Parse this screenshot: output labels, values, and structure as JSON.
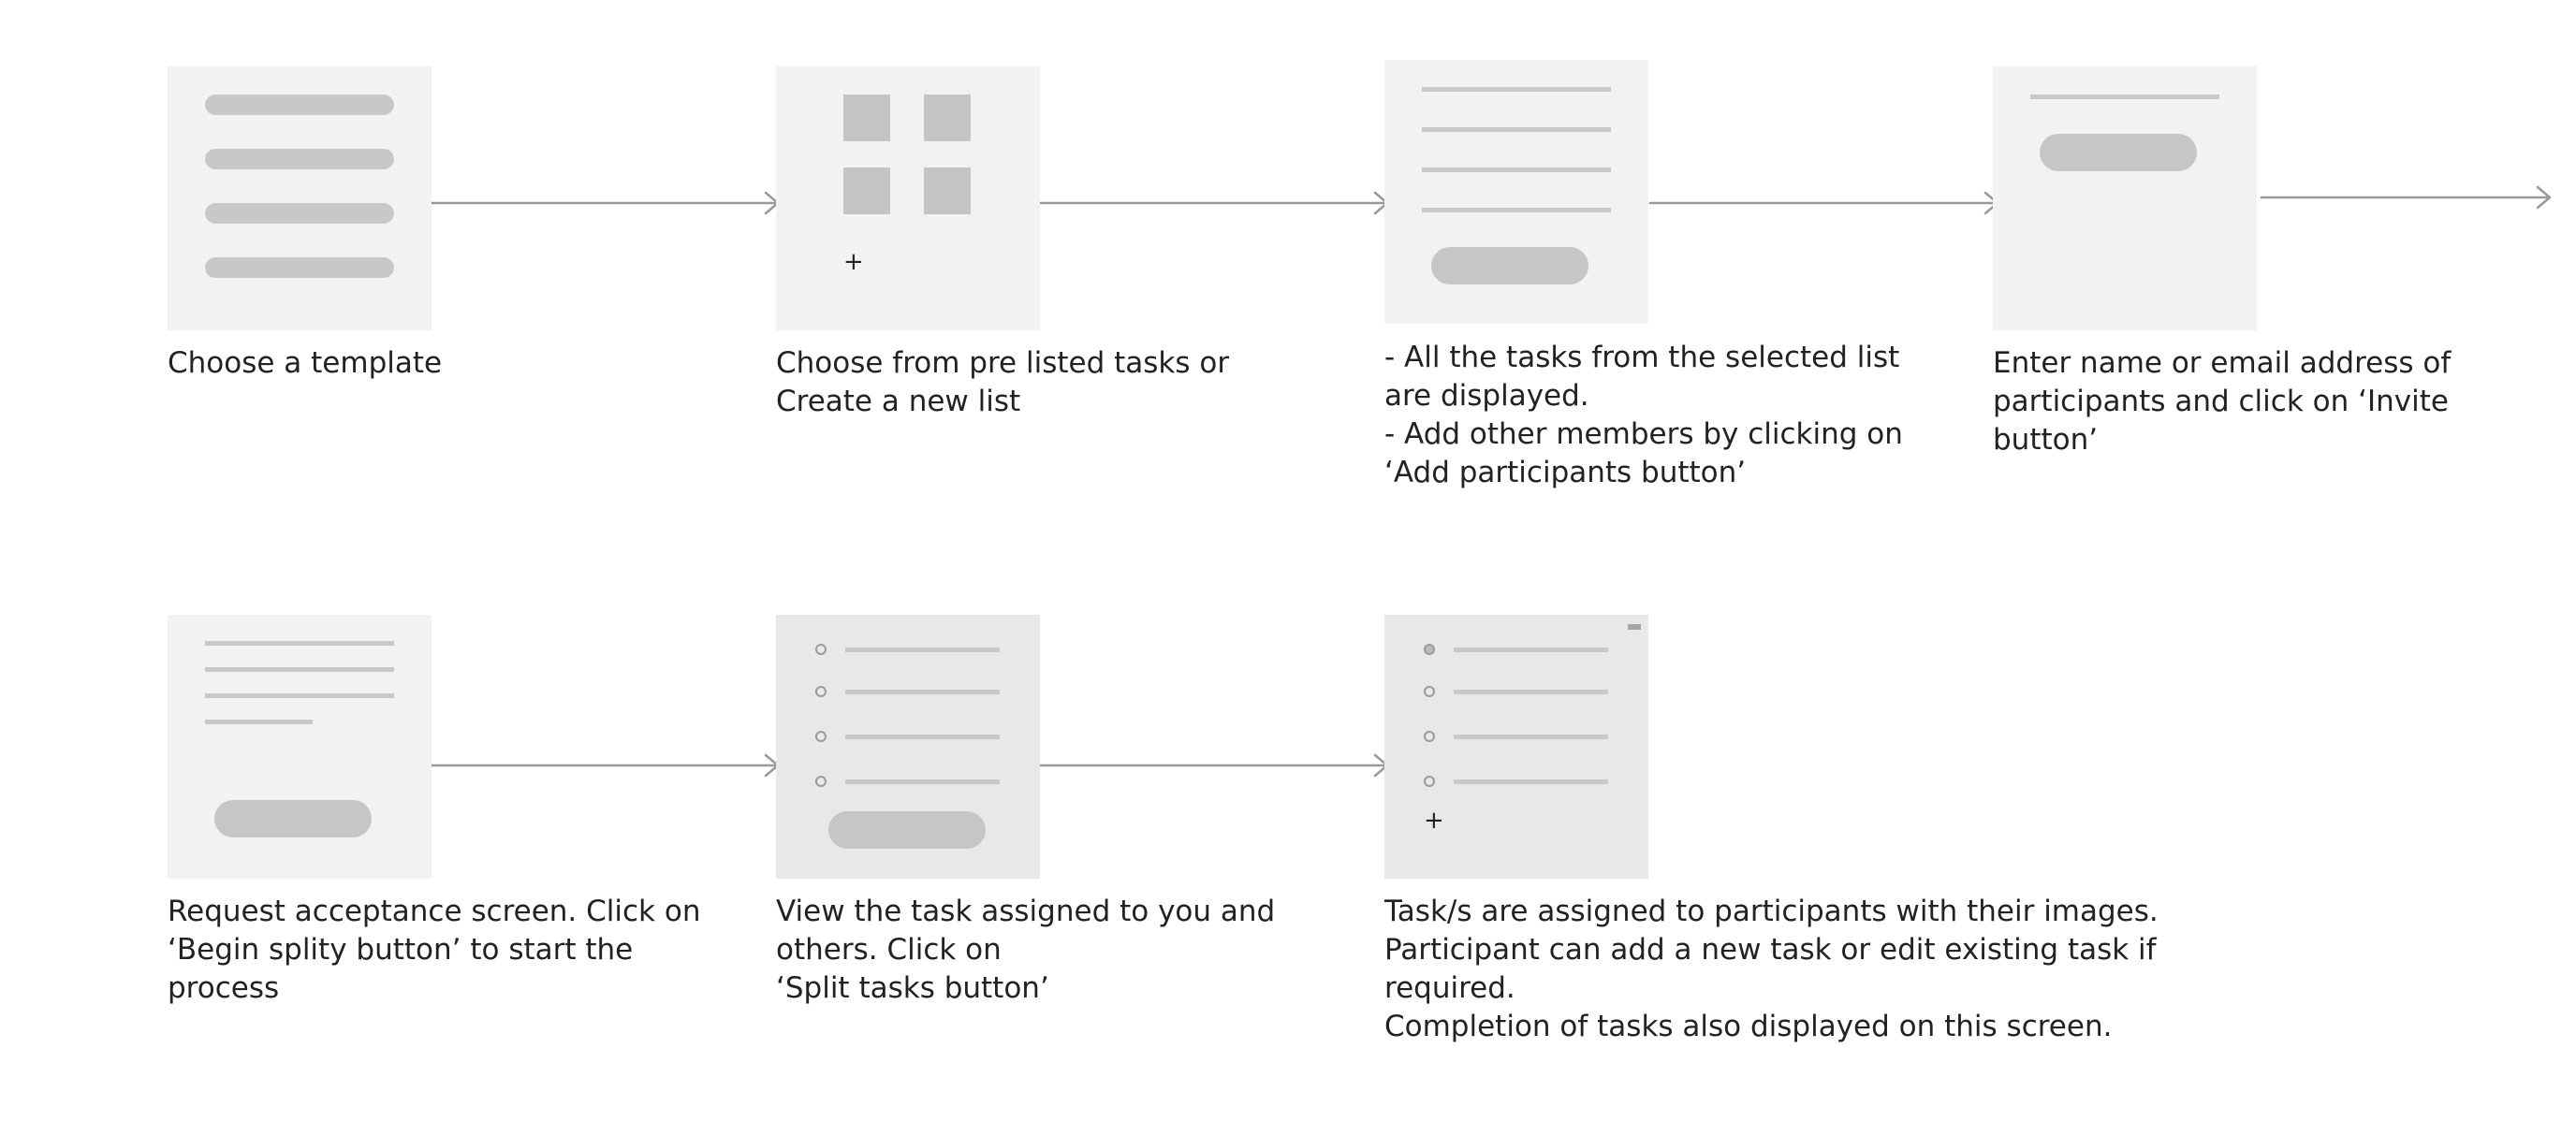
{
  "colors": {
    "screen_background": "#f2f2f2",
    "placeholder_gray": "#c8c8c8",
    "arrow_gray": "#999999",
    "text": "#222222"
  },
  "steps": [
    {
      "caption": "Choose a template",
      "wireframe": "template-list"
    },
    {
      "caption": "Choose from pre listed tasks or\nCreate a new list",
      "wireframe": "task-grid",
      "icon": "+"
    },
    {
      "caption": "- All the tasks from the selected list\nare displayed.\n- Add other members by clicking on\n‘Add participants button’",
      "wireframe": "task-list-with-button"
    },
    {
      "caption": "Enter name or email address of\nparticipants and click on ‘Invite\nbutton’",
      "wireframe": "invite-form"
    },
    {
      "caption": "Request acceptance screen. Click on\n‘Begin splity button’ to start the\nprocess",
      "wireframe": "request-acceptance"
    },
    {
      "caption": "View the task assigned to you and\nothers. Click on\n‘Split tasks button’",
      "wireframe": "assigned-tasks"
    },
    {
      "caption": "Task/s are assigned to participants with their images.\nParticipant can add a new task or edit existing task if\nrequired.\nCompletion of tasks also displayed on this screen.",
      "wireframe": "task-completion",
      "icon": "+"
    }
  ]
}
